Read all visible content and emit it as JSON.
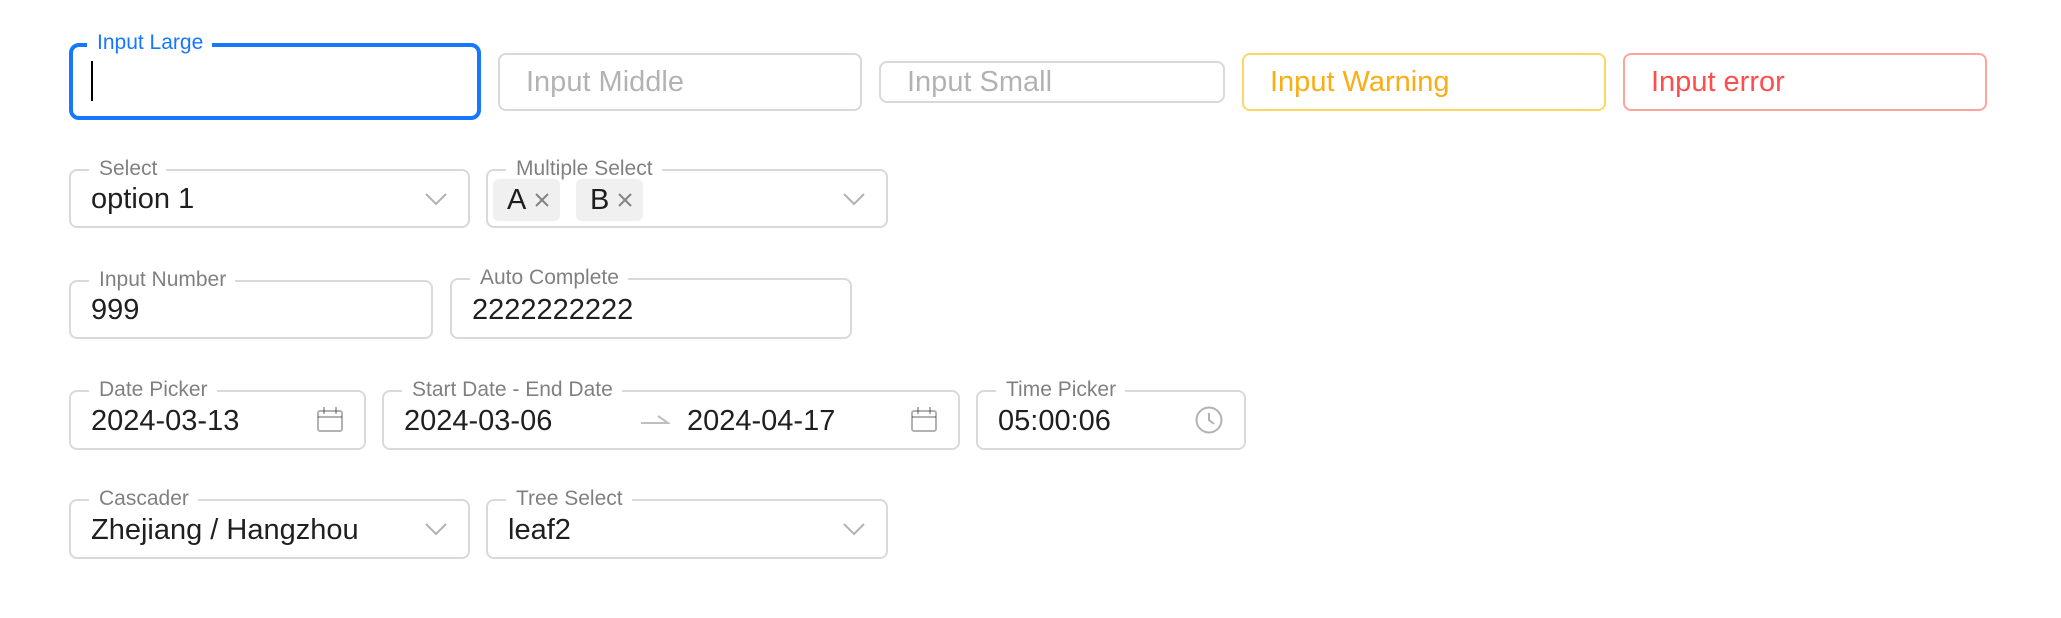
{
  "row1": {
    "large": {
      "label": "Input Large",
      "value": ""
    },
    "middle": {
      "placeholder": "Input Middle"
    },
    "small": {
      "placeholder": "Input Small"
    },
    "warning": {
      "placeholder": "Input Warning"
    },
    "error": {
      "placeholder": "Input error"
    }
  },
  "select": {
    "label": "Select",
    "value": "option 1"
  },
  "multi_select": {
    "label": "Multiple Select",
    "tags": [
      "A",
      "B"
    ]
  },
  "input_number": {
    "label": "Input Number",
    "value": "999"
  },
  "auto_complete": {
    "label": "Auto Complete",
    "value": "2222222222"
  },
  "date_picker": {
    "label": "Date Picker",
    "value": "2024-03-13"
  },
  "range_picker": {
    "label": "Start Date - End Date",
    "start": "2024-03-06",
    "end": "2024-04-17"
  },
  "time_picker": {
    "label": "Time Picker",
    "value": "05:00:06"
  },
  "cascader": {
    "label": "Cascader",
    "value": "Zhejiang / Hangzhou"
  },
  "tree_select": {
    "label": "Tree Select",
    "value": "leaf2"
  },
  "colors": {
    "primary": "#1677ff",
    "warning": "#faad14",
    "error": "#ff4d4f",
    "border": "#d9d9d9"
  },
  "icons": [
    "chevron-down-icon",
    "close-icon",
    "calendar-icon",
    "swap-arrow-icon",
    "clock-icon"
  ]
}
